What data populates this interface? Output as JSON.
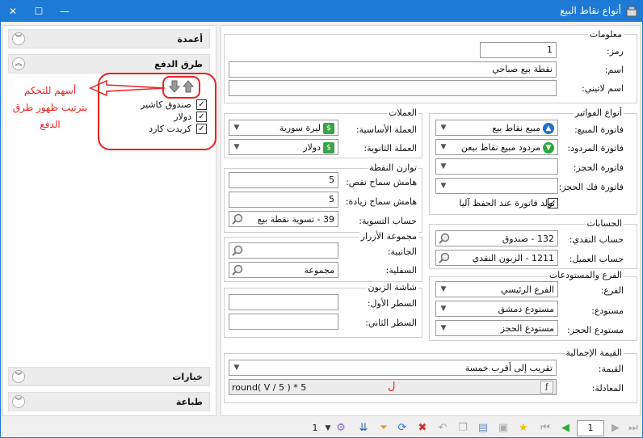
{
  "window": {
    "title": "أنواع نقاط البيع"
  },
  "sidebar": {
    "columns_label": "أعمدة",
    "payment_methods_label": "طرق الدفع",
    "payment_methods": [
      {
        "label": "صندوق كاشير",
        "checked": true
      },
      {
        "label": "دولار",
        "checked": true
      },
      {
        "label": "كريدت كارد",
        "checked": true
      }
    ],
    "annotation_line1": "أسهم للتحكم",
    "annotation_line2": "بترتيب ظهور طرق",
    "annotation_line3": "الدفع",
    "options_label": "خيارات",
    "print_label": "طباعة"
  },
  "info": {
    "group_label": "معلومات",
    "code_label": "رمز:",
    "code_value": "1",
    "name_label": "اسم:",
    "name_value": "نقطة بيع صباحي",
    "latin_name_label": "اسم لاتيني:",
    "latin_name_value": ""
  },
  "currencies": {
    "group_label": "العملات",
    "base_label": "العملة الأساسية:",
    "base_value": "ليرة سورية",
    "secondary_label": "العملة الثانوية:",
    "secondary_value": "دولار"
  },
  "balance": {
    "group_label": "توازن النقطة",
    "deficit_label": "هامش سماح نقص:",
    "deficit_value": "5",
    "surplus_label": "هامش سماح زيادة:",
    "surplus_value": "5",
    "settlement_label": "حساب التسوية:",
    "settlement_value": "39 - تسوية نقطة بيع"
  },
  "buttons_group": {
    "group_label": "مجموعة الأزرار",
    "side_label": "الجانبية:",
    "side_value": "",
    "bottom_label": "السفلية:",
    "bottom_value": "مجموعة"
  },
  "customer_screen": {
    "group_label": "شاشة الزبون",
    "line1_label": "السطر الأول:",
    "line1_value": "",
    "line2_label": "السطر الثاني:",
    "line2_value": ""
  },
  "invoices": {
    "group_label": "أنواع الفواتير",
    "sale_label": "فاتورة المبيع:",
    "sale_value": "مبيع نقاط بيع",
    "return_label": "فاتورة المردود:",
    "return_value": "مردود مبيع نقاط بيعن",
    "reserve_label": "فاتورة الحجز:",
    "reserve_value": "",
    "unreserve_label": "فاتورة فك الحجز:",
    "unreserve_value": "",
    "auto_generate_label": "تولد فاتورة عند الحفظ آليا",
    "auto_generate_checked": true
  },
  "accounts": {
    "group_label": "الحسابات",
    "cash_label": "حساب النقدي:",
    "cash_value": "132 - صندوق",
    "customer_label": "حساب العميل:",
    "customer_value": "1211 - الزبون النقدي"
  },
  "branch": {
    "group_label": "الفرع والمستودعات",
    "branch_label": "الفرع:",
    "branch_value": "الفرع الرئيسي",
    "warehouse_label": "مستودع:",
    "warehouse_value": "مستودع دمشق",
    "reserve_wh_label": "مستودع الحجز:",
    "reserve_wh_value": "مستودع الحجز"
  },
  "total": {
    "group_label": "القيمة الإجمالية",
    "value_label": "القيمة:",
    "value_value": "تقريب إلى أقرب خمسة",
    "equation_label": "المعادلة:",
    "equation_value": "round( V / 5 ) * 5",
    "equation_mark": "ل"
  },
  "nav": {
    "records_count": "1",
    "page_value": "1"
  }
}
